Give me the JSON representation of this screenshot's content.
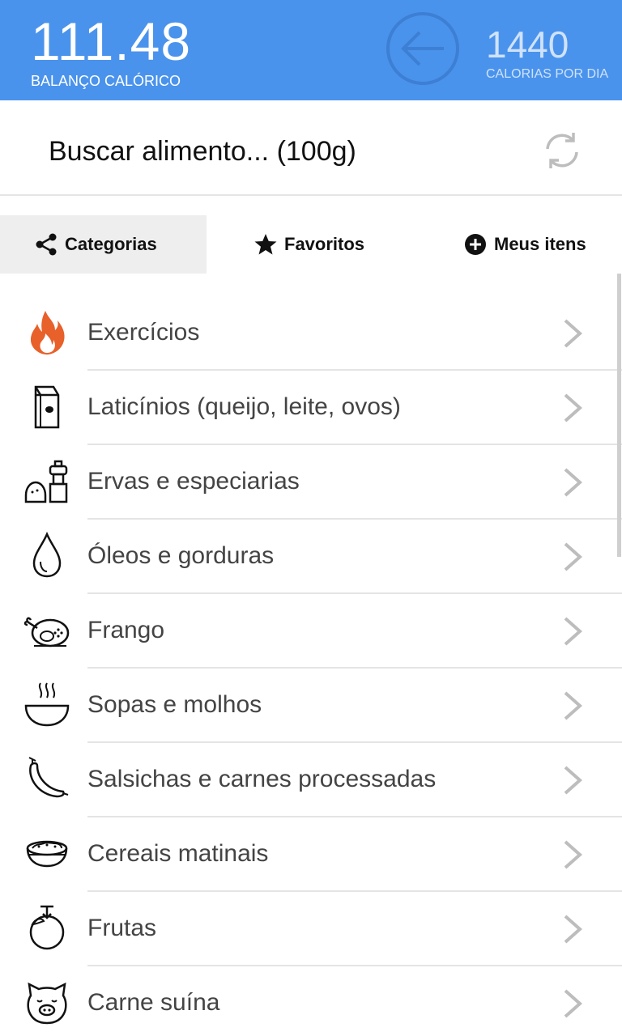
{
  "header": {
    "balance_value": "111.48",
    "balance_label": "BALANÇO CALÓRICO",
    "daily_value": "1440",
    "daily_label": "CALORIAS POR DIA",
    "back_icon": "arrow-left-circle-icon"
  },
  "search": {
    "text": "Buscar alimento... (100g)",
    "refresh_icon": "refresh-icon"
  },
  "tabs": [
    {
      "label": "Categorias",
      "icon": "share-icon",
      "active": true
    },
    {
      "label": "Favoritos",
      "icon": "star-icon",
      "active": false
    },
    {
      "label": "Meus itens",
      "icon": "plus-circle-icon",
      "active": false
    }
  ],
  "categories": [
    {
      "label": "Exercícios",
      "icon": "flame-icon"
    },
    {
      "label": "Laticínios (queijo, leite, ovos)",
      "icon": "milk-carton-icon"
    },
    {
      "label": "Ervas e especiarias",
      "icon": "salt-pepper-icon"
    },
    {
      "label": "Óleos e gorduras",
      "icon": "oil-drop-icon"
    },
    {
      "label": "Frango",
      "icon": "roast-chicken-icon"
    },
    {
      "label": "Sopas e molhos",
      "icon": "soup-bowl-icon"
    },
    {
      "label": "Salsichas e carnes processadas",
      "icon": "sausage-icon"
    },
    {
      "label": "Cereais matinais",
      "icon": "cereal-bowl-icon"
    },
    {
      "label": "Frutas",
      "icon": "fruit-icon"
    },
    {
      "label": "Carne suína",
      "icon": "pig-icon"
    }
  ],
  "colors": {
    "header_bg": "#4a93ec",
    "accent_flame": "#e8602a",
    "active_tab_bg": "#eeeeee"
  }
}
